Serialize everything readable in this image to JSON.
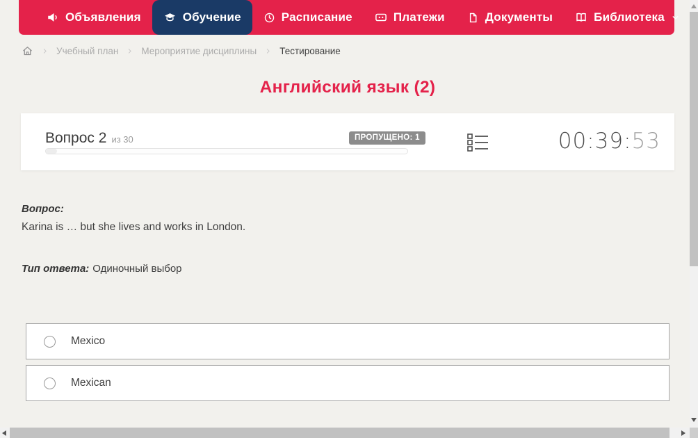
{
  "colors": {
    "accent": "#e4224a",
    "active_tab": "#1a3a66",
    "page_bg": "#f2f1ed",
    "badge_bg": "#8c8c8c",
    "scroll_thumb": "#c1c1c1",
    "scroll_track": "#f1f1f1"
  },
  "nav": {
    "items": [
      {
        "label": "Объявления",
        "icon": "megaphone-icon",
        "active": false
      },
      {
        "label": "Обучение",
        "icon": "graduation-cap-icon",
        "active": true
      },
      {
        "label": "Расписание",
        "icon": "clock-icon",
        "active": false
      },
      {
        "label": "Платежи",
        "icon": "wallet-icon",
        "active": false
      },
      {
        "label": "Документы",
        "icon": "document-icon",
        "active": false
      },
      {
        "label": "Библиотека",
        "icon": "book-icon",
        "active": false,
        "has_dropdown": true
      }
    ]
  },
  "breadcrumb": {
    "items": [
      "Учебный план",
      "Мероприятие дисциплины",
      "Тестирование"
    ]
  },
  "page": {
    "title": "Английский язык (2)"
  },
  "quiz": {
    "question_number": "Вопрос 2",
    "question_total": "из 30",
    "skipped_badge": "ПРОПУЩЕНО: 1",
    "progress": {
      "current": 2,
      "total": 30
    },
    "timer": {
      "hours_minutes": "00:39:",
      "seconds": "53"
    },
    "question_heading": "Вопрос:",
    "question_text": "Karina is … but she lives and works in London.",
    "answer_type_label": "Тип ответа:",
    "answer_type_value": "Одиночный выбор",
    "options": [
      "Mexico",
      "Mexican"
    ]
  }
}
